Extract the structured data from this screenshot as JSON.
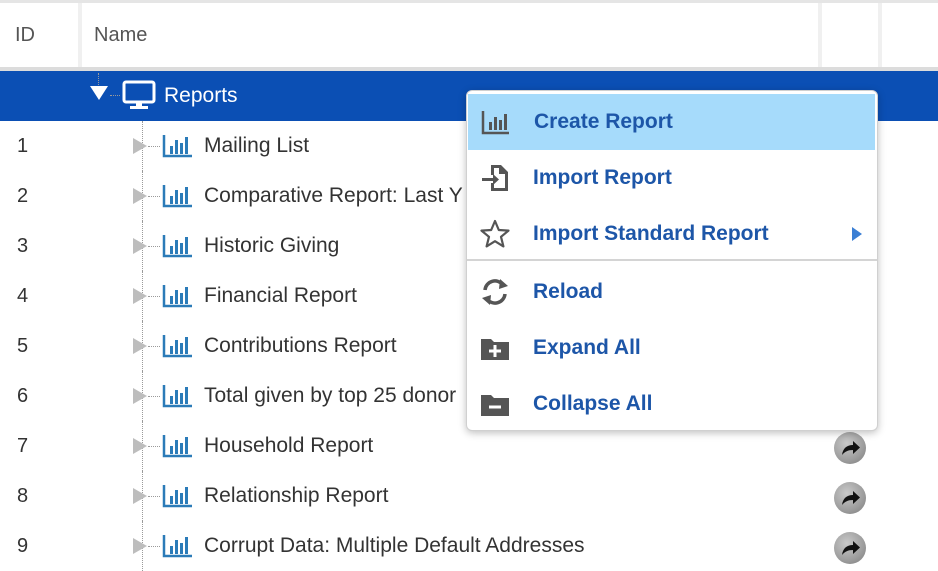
{
  "header": {
    "col_id": "ID",
    "col_name": "Name"
  },
  "root": {
    "label": "Reports"
  },
  "rows": [
    {
      "id": "1",
      "name": "Mailing List",
      "has_action": false
    },
    {
      "id": "2",
      "name": "Comparative Report: Last Y",
      "has_action": false
    },
    {
      "id": "3",
      "name": "Historic Giving",
      "has_action": false
    },
    {
      "id": "4",
      "name": "Financial Report",
      "has_action": false
    },
    {
      "id": "5",
      "name": "Contributions Report",
      "has_action": false
    },
    {
      "id": "6",
      "name": "Total given by top 25 donor",
      "has_action": false
    },
    {
      "id": "7",
      "name": "Household Report",
      "has_action": true
    },
    {
      "id": "8",
      "name": "Relationship Report",
      "has_action": true
    },
    {
      "id": "9",
      "name": "Corrupt Data: Multiple Default Addresses",
      "has_action": true
    }
  ],
  "context_menu": {
    "items": [
      {
        "label": "Create Report",
        "icon": "bar-chart-icon"
      },
      {
        "label": "Import Report",
        "icon": "file-import-icon"
      },
      {
        "label": "Import Standard Report",
        "icon": "star-outline-icon",
        "submenu": true
      },
      {
        "label": "Reload",
        "icon": "refresh-icon"
      },
      {
        "label": "Expand All",
        "icon": "folder-plus-icon"
      },
      {
        "label": "Collapse All",
        "icon": "folder-minus-icon"
      }
    ],
    "highlighted_index": 0
  },
  "colors": {
    "selected_row": "#0b4fb4",
    "menu_text": "#1d56a8",
    "menu_highlight": "#a6dbfb",
    "report_icon": "#2b7bb8"
  }
}
